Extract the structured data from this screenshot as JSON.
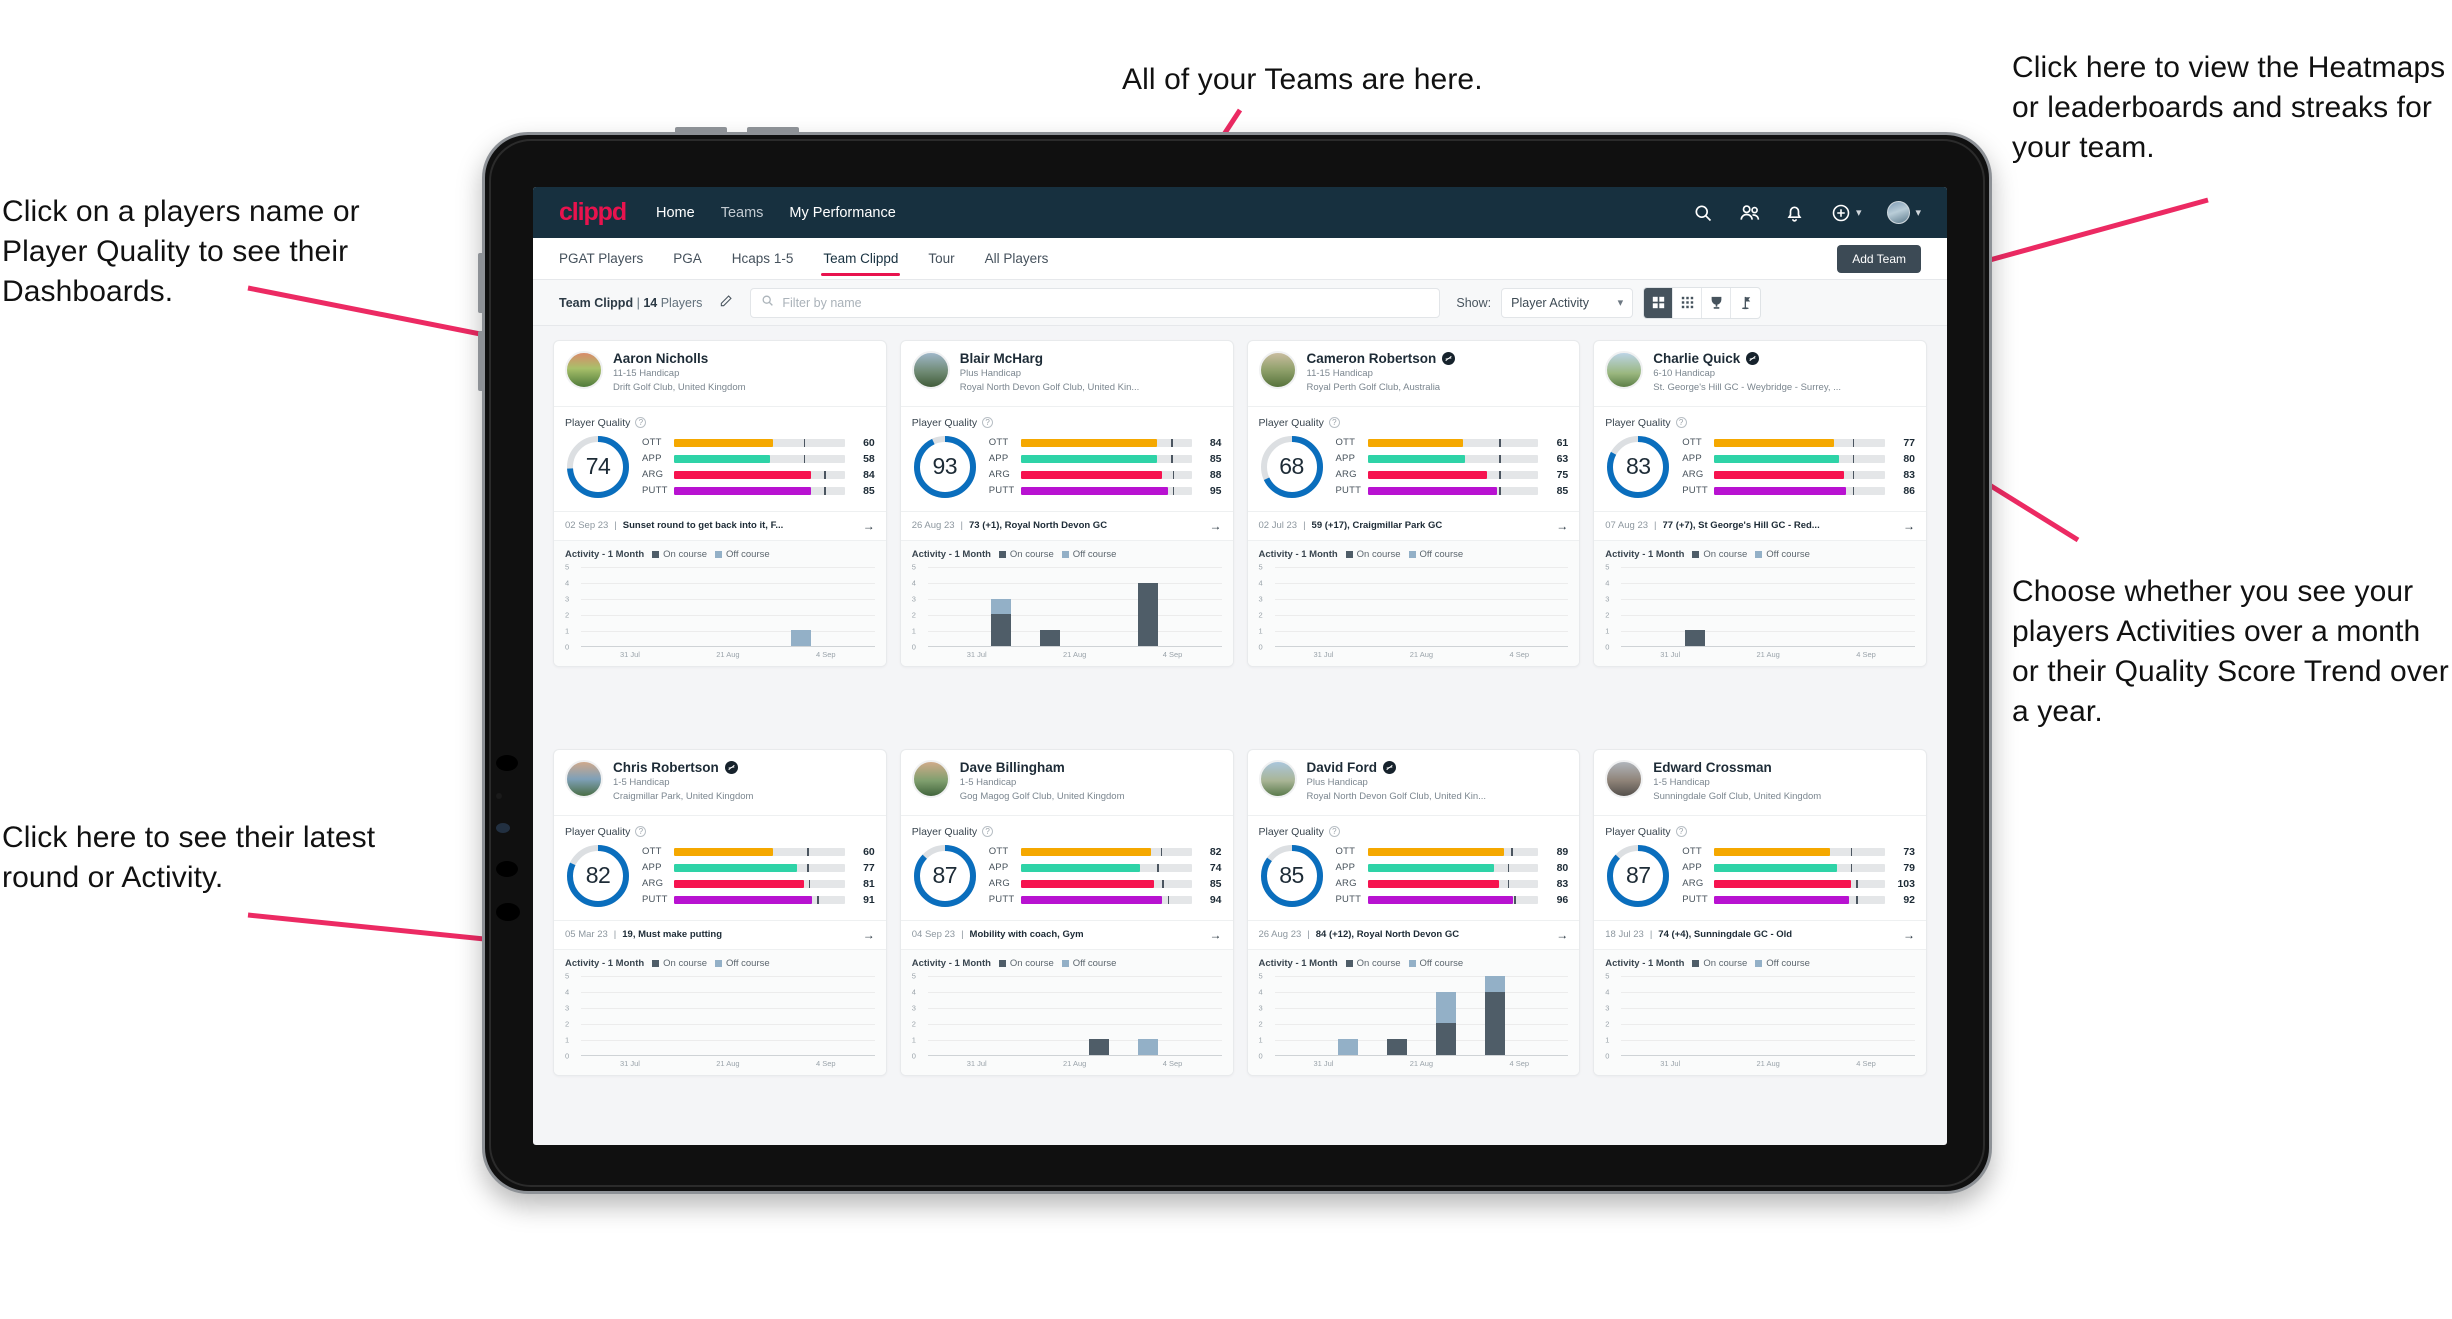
{
  "annotations": {
    "players_name": "Click on a players name or Player Quality to see their Dashboards.",
    "teams": "All of your Teams are here.",
    "heatmaps": "Click here to view the Heatmaps or leaderboards and streaks for your team.",
    "choose": "Choose whether you see your players Activities over a month or their Quality Score Trend over a year.",
    "latest_round": "Click here to see their latest round or Activity."
  },
  "navbar": {
    "brand": "clippd",
    "links": [
      {
        "label": "Home",
        "active": true
      },
      {
        "label": "Teams",
        "active": false
      },
      {
        "label": "My Performance",
        "active": true
      }
    ],
    "icons": [
      "search-icon",
      "people-icon",
      "bell-icon",
      "plus-circle-icon",
      "avatar"
    ]
  },
  "tabs": [
    {
      "label": "PGAT Players",
      "active": false
    },
    {
      "label": "PGA",
      "active": false
    },
    {
      "label": "Hcaps 1-5",
      "active": false
    },
    {
      "label": "Team Clippd",
      "active": true
    },
    {
      "label": "Tour",
      "active": false
    },
    {
      "label": "All Players",
      "active": false
    }
  ],
  "add_team_label": "Add Team",
  "toolbar": {
    "team_name": "Team Clippd",
    "separator": "|",
    "player_count": "14",
    "players_word": "Players",
    "edit_icon": "pencil-icon",
    "search_placeholder": "Filter by name",
    "search_value": "",
    "show_label": "Show:",
    "show_value": "Player Activity",
    "view_modes": [
      {
        "name": "grid-large-view",
        "active": true
      },
      {
        "name": "grid-dense-view",
        "active": false
      },
      {
        "name": "trophy-view",
        "active": false
      },
      {
        "name": "flag-view",
        "active": false
      }
    ]
  },
  "card_labels": {
    "player_quality": "Player Quality",
    "activity": "Activity - 1 Month",
    "legend_on": "On course",
    "legend_off": "Off course",
    "metric_labels": [
      "OTT",
      "APP",
      "ARG",
      "PUTT"
    ],
    "y_ticks": [
      "5",
      "4",
      "3",
      "2",
      "1",
      "0"
    ],
    "x_ticks": [
      "31 Jul",
      "21 Aug",
      "4 Sep"
    ]
  },
  "metric_colors": {
    "OTT": "#f5a800",
    "APP": "#2ed3a7",
    "ARG": "#f3records",
    "ARG_color": "#f6134f",
    "PUTT": "#b812d1",
    "ring": "#0a6ebd",
    "ring_track": "#dcdfe2"
  },
  "players": [
    {
      "name": "Aaron Nicholls",
      "verified": false,
      "handicap": "11-15 Handicap",
      "club": "Drift Golf Club, United Kingdom",
      "quality": 74,
      "metrics": [
        {
          "label": "OTT",
          "value": 60,
          "fill": 58,
          "tick": 76
        },
        {
          "label": "APP",
          "value": 58,
          "fill": 56,
          "tick": 76
        },
        {
          "label": "ARG",
          "value": 84,
          "fill": 80,
          "tick": 88
        },
        {
          "label": "PUTT",
          "value": 85,
          "fill": 80,
          "tick": 88
        }
      ],
      "round_date": "02 Sep 23",
      "round_text": "Sunset round to get back into it, F...",
      "chart": {
        "type": "bar",
        "categories": [
          "31 Jul",
          "21 Aug",
          "4 Sep"
        ],
        "ymax": 5,
        "bars": [
          {
            "x": 0.1,
            "on": 0,
            "off": 0
          },
          {
            "x": 0.25,
            "on": 0,
            "off": 0
          },
          {
            "x": 0.4,
            "on": 0,
            "off": 0
          },
          {
            "x": 0.55,
            "on": 0,
            "off": 0
          },
          {
            "x": 0.7,
            "on": 0,
            "off": 1
          },
          {
            "x": 0.85,
            "on": 0,
            "off": 0
          }
        ]
      }
    },
    {
      "name": "Blair McHarg",
      "verified": false,
      "handicap": "Plus Handicap",
      "club": "Royal North Devon Golf Club, United Kin...",
      "quality": 93,
      "metrics": [
        {
          "label": "OTT",
          "value": 84,
          "fill": 80,
          "tick": 88
        },
        {
          "label": "APP",
          "value": 85,
          "fill": 80,
          "tick": 88
        },
        {
          "label": "ARG",
          "value": 88,
          "fill": 83,
          "tick": 89
        },
        {
          "label": "PUTT",
          "value": 95,
          "fill": 86,
          "tick": 89
        }
      ],
      "round_date": "26 Aug 23",
      "round_text": "73 (+1), Royal North Devon GC",
      "chart": {
        "type": "bar",
        "categories": [
          "31 Jul",
          "21 Aug",
          "4 Sep"
        ],
        "ymax": 5,
        "bars": [
          {
            "x": 0.1,
            "on": 0,
            "off": 0
          },
          {
            "x": 0.22,
            "on": 2,
            "off": 1
          },
          {
            "x": 0.36,
            "on": 1,
            "off": 0
          },
          {
            "x": 0.5,
            "on": 0,
            "off": 0
          },
          {
            "x": 0.62,
            "on": 4,
            "off": 0
          },
          {
            "x": 0.8,
            "on": 0,
            "off": 0
          }
        ]
      }
    },
    {
      "name": "Cameron Robertson",
      "verified": true,
      "handicap": "11-15 Handicap",
      "club": "Royal Perth Golf Club, Australia",
      "quality": 68,
      "metrics": [
        {
          "label": "OTT",
          "value": 61,
          "fill": 56,
          "tick": 77
        },
        {
          "label": "APP",
          "value": 63,
          "fill": 57,
          "tick": 77
        },
        {
          "label": "ARG",
          "value": 75,
          "fill": 70,
          "tick": 77
        },
        {
          "label": "PUTT",
          "value": 85,
          "fill": 76,
          "tick": 77
        }
      ],
      "round_date": "02 Jul 23",
      "round_text": "59 (+17), Craigmillar Park GC",
      "chart": {
        "type": "bar",
        "categories": [
          "31 Jul",
          "21 Aug",
          "4 Sep"
        ],
        "ymax": 5,
        "bars": [
          {
            "x": 0.1,
            "on": 0,
            "off": 0
          },
          {
            "x": 0.25,
            "on": 0,
            "off": 0
          },
          {
            "x": 0.4,
            "on": 0,
            "off": 0
          },
          {
            "x": 0.55,
            "on": 0,
            "off": 0
          },
          {
            "x": 0.7,
            "on": 0,
            "off": 0
          },
          {
            "x": 0.85,
            "on": 0,
            "off": 0
          }
        ]
      }
    },
    {
      "name": "Charlie Quick",
      "verified": true,
      "handicap": "6-10 Handicap",
      "club": "St. George's Hill GC - Weybridge - Surrey, ...",
      "quality": 83,
      "metrics": [
        {
          "label": "OTT",
          "value": 77,
          "fill": 70,
          "tick": 81
        },
        {
          "label": "APP",
          "value": 80,
          "fill": 73,
          "tick": 81
        },
        {
          "label": "ARG",
          "value": 83,
          "fill": 76,
          "tick": 81
        },
        {
          "label": "PUTT",
          "value": 86,
          "fill": 77,
          "tick": 81
        }
      ],
      "round_date": "07 Aug 23",
      "round_text": "77 (+7), St George's Hill GC - Red...",
      "chart": {
        "type": "bar",
        "categories": [
          "31 Jul",
          "21 Aug",
          "4 Sep"
        ],
        "ymax": 5,
        "bars": [
          {
            "x": 0.1,
            "on": 0,
            "off": 0
          },
          {
            "x": 0.28,
            "on": 1,
            "off": 0
          },
          {
            "x": 0.42,
            "on": 0,
            "off": 0
          },
          {
            "x": 0.56,
            "on": 0,
            "off": 0
          },
          {
            "x": 0.7,
            "on": 0,
            "off": 0
          },
          {
            "x": 0.85,
            "on": 0,
            "off": 0
          }
        ]
      }
    },
    {
      "name": "Chris Robertson",
      "verified": true,
      "handicap": "1-5 Handicap",
      "club": "Craigmillar Park, United Kingdom",
      "quality": 82,
      "metrics": [
        {
          "label": "OTT",
          "value": 60,
          "fill": 58,
          "tick": 78
        },
        {
          "label": "APP",
          "value": 77,
          "fill": 72,
          "tick": 78
        },
        {
          "label": "ARG",
          "value": 81,
          "fill": 76,
          "tick": 79
        },
        {
          "label": "PUTT",
          "value": 91,
          "fill": 81,
          "tick": 84
        }
      ],
      "round_date": "05 Mar 23",
      "round_text": "19, Must make putting",
      "chart": {
        "type": "bar",
        "categories": [
          "31 Jul",
          "21 Aug",
          "4 Sep"
        ],
        "ymax": 5,
        "bars": [
          {
            "x": 0.1,
            "on": 0,
            "off": 0
          },
          {
            "x": 0.25,
            "on": 0,
            "off": 0
          },
          {
            "x": 0.4,
            "on": 0,
            "off": 0
          },
          {
            "x": 0.55,
            "on": 0,
            "off": 0
          },
          {
            "x": 0.7,
            "on": 0,
            "off": 0
          },
          {
            "x": 0.85,
            "on": 0,
            "off": 0
          }
        ]
      }
    },
    {
      "name": "Dave Billingham",
      "verified": false,
      "handicap": "1-5 Handicap",
      "club": "Gog Magog Golf Club, United Kingdom",
      "quality": 87,
      "metrics": [
        {
          "label": "OTT",
          "value": 82,
          "fill": 76,
          "tick": 82
        },
        {
          "label": "APP",
          "value": 74,
          "fill": 70,
          "tick": 80
        },
        {
          "label": "ARG",
          "value": 85,
          "fill": 78,
          "tick": 83
        },
        {
          "label": "PUTT",
          "value": 94,
          "fill": 83,
          "tick": 86
        }
      ],
      "round_date": "04 Sep 23",
      "round_text": "Mobility with coach, Gym",
      "chart": {
        "type": "bar",
        "categories": [
          "31 Jul",
          "21 Aug",
          "4 Sep"
        ],
        "ymax": 5,
        "bars": [
          {
            "x": 0.1,
            "on": 0,
            "off": 0
          },
          {
            "x": 0.25,
            "on": 0,
            "off": 0
          },
          {
            "x": 0.4,
            "on": 0,
            "off": 0
          },
          {
            "x": 0.58,
            "on": 1,
            "off": 0
          },
          {
            "x": 0.72,
            "on": 0,
            "off": 1
          },
          {
            "x": 0.88,
            "on": 0,
            "off": 0
          }
        ]
      }
    },
    {
      "name": "David Ford",
      "verified": true,
      "handicap": "Plus Handicap",
      "club": "Royal North Devon Golf Club, United Kin...",
      "quality": 85,
      "metrics": [
        {
          "label": "OTT",
          "value": 89,
          "fill": 80,
          "tick": 84
        },
        {
          "label": "APP",
          "value": 80,
          "fill": 74,
          "tick": 82
        },
        {
          "label": "ARG",
          "value": 83,
          "fill": 77,
          "tick": 82
        },
        {
          "label": "PUTT",
          "value": 96,
          "fill": 85,
          "tick": 86
        }
      ],
      "round_date": "26 Aug 23",
      "round_text": "84 (+12), Royal North Devon GC",
      "chart": {
        "type": "bar",
        "categories": [
          "31 Jul",
          "21 Aug",
          "4 Sep"
        ],
        "ymax": 5,
        "bars": [
          {
            "x": 0.1,
            "on": 0,
            "off": 0
          },
          {
            "x": 0.22,
            "on": 0,
            "off": 1
          },
          {
            "x": 0.36,
            "on": 1,
            "off": 0
          },
          {
            "x": 0.5,
            "on": 2,
            "off": 2
          },
          {
            "x": 0.64,
            "on": 4,
            "off": 1
          },
          {
            "x": 0.82,
            "on": 0,
            "off": 0
          }
        ]
      }
    },
    {
      "name": "Edward Crossman",
      "verified": false,
      "handicap": "1-5 Handicap",
      "club": "Sunningdale Golf Club, United Kingdom",
      "quality": 87,
      "metrics": [
        {
          "label": "OTT",
          "value": 73,
          "fill": 68,
          "tick": 80
        },
        {
          "label": "APP",
          "value": 79,
          "fill": 72,
          "tick": 80
        },
        {
          "label": "ARG",
          "value": 103,
          "fill": 80,
          "tick": 83
        },
        {
          "label": "PUTT",
          "value": 92,
          "fill": 79,
          "tick": 83
        }
      ],
      "round_date": "18 Jul 23",
      "round_text": "74 (+4), Sunningdale GC - Old",
      "chart": {
        "type": "bar",
        "categories": [
          "31 Jul",
          "21 Aug",
          "4 Sep"
        ],
        "ymax": 5,
        "bars": [
          {
            "x": 0.1,
            "on": 0,
            "off": 0
          },
          {
            "x": 0.25,
            "on": 0,
            "off": 0
          },
          {
            "x": 0.4,
            "on": 0,
            "off": 0
          },
          {
            "x": 0.55,
            "on": 0,
            "off": 0
          },
          {
            "x": 0.7,
            "on": 0,
            "off": 0
          },
          {
            "x": 0.85,
            "on": 0,
            "off": 0
          }
        ]
      }
    }
  ]
}
